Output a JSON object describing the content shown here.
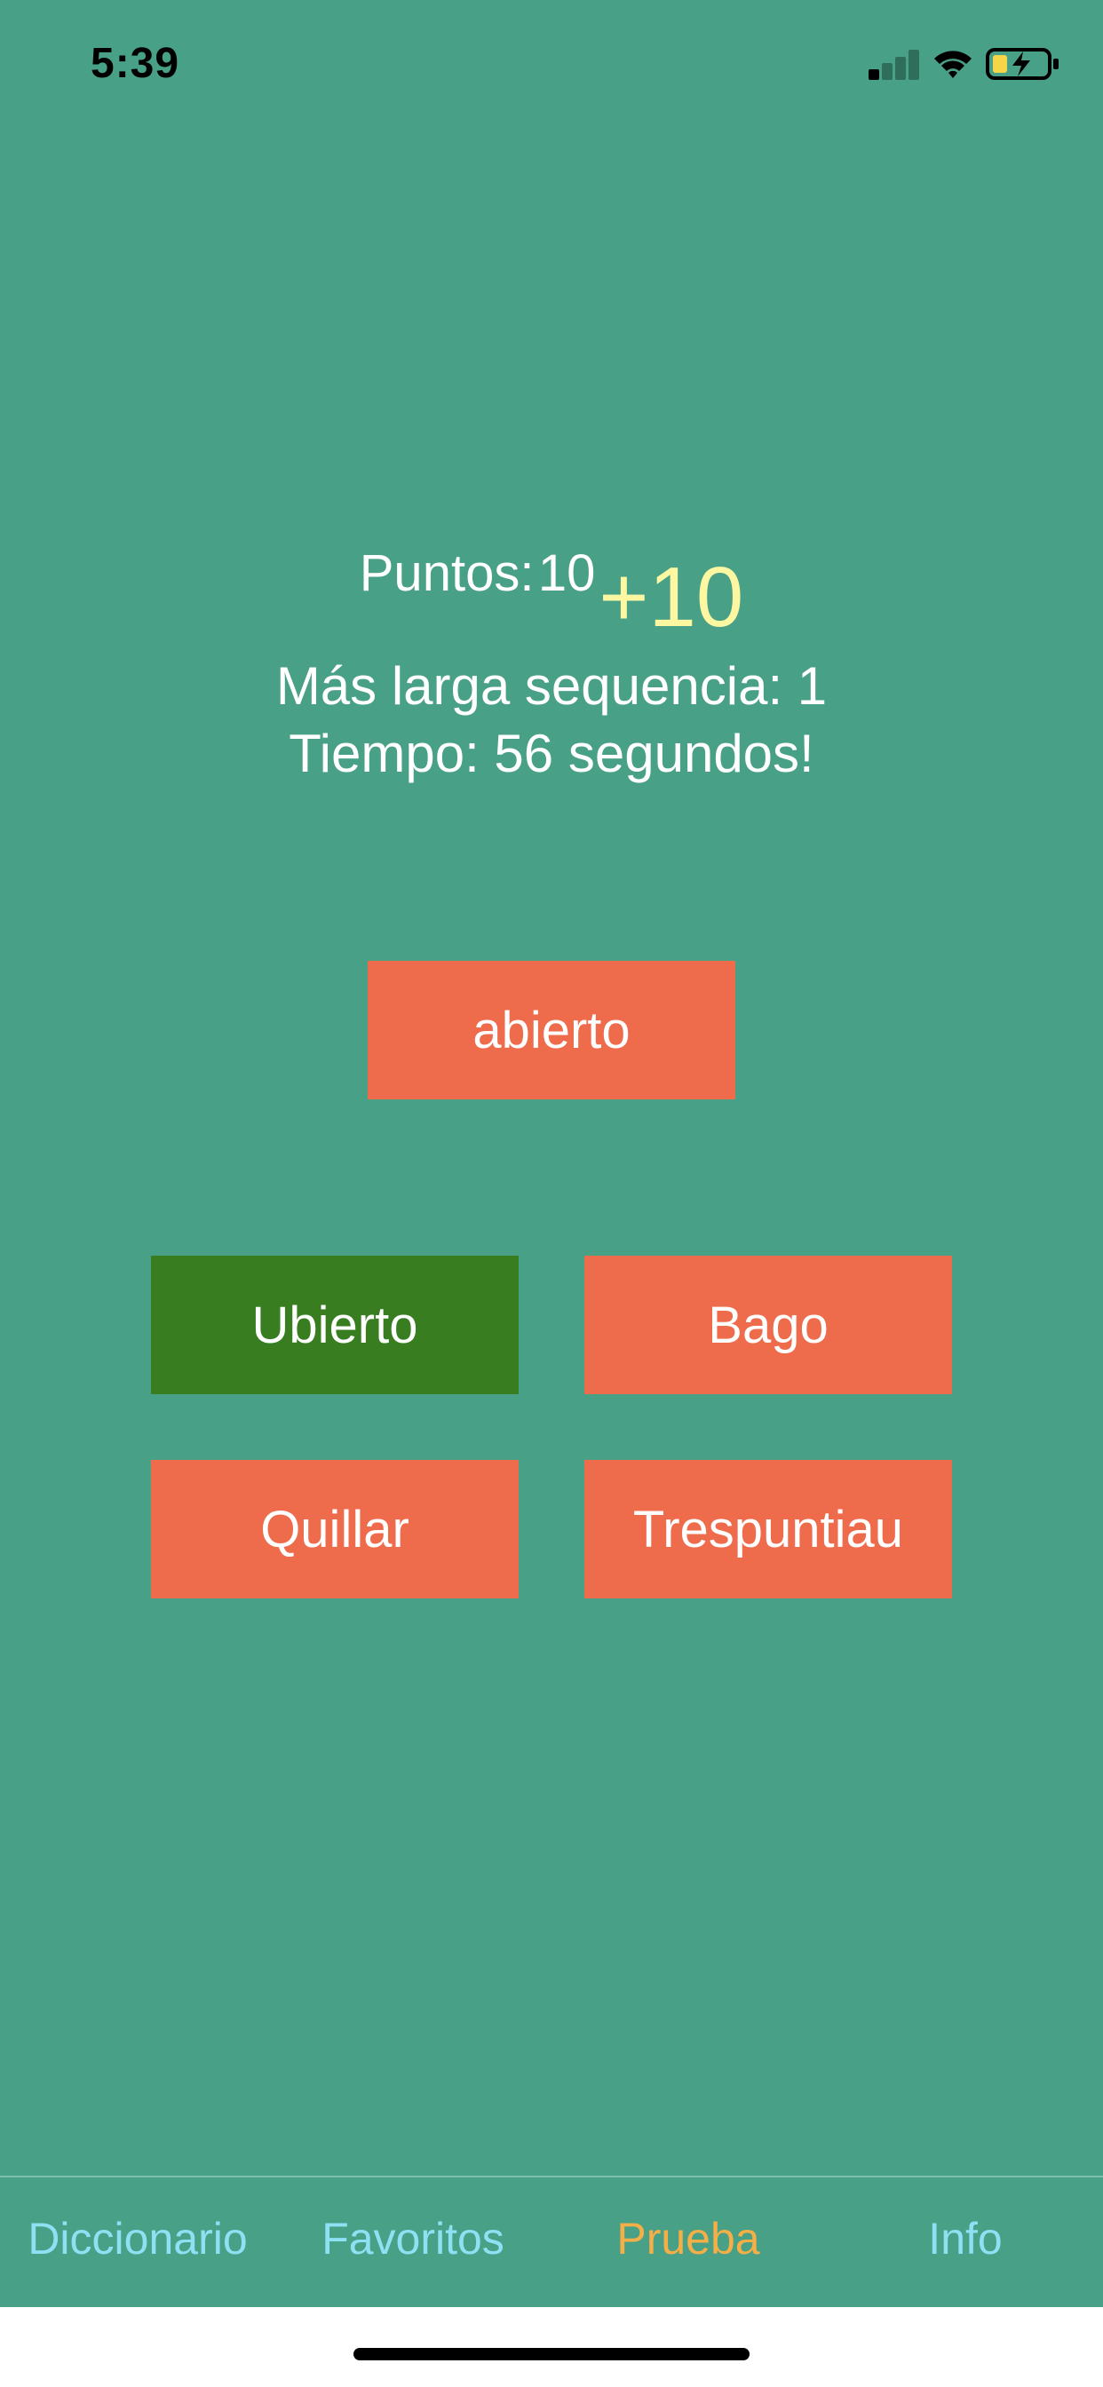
{
  "status_bar": {
    "time": "5:39"
  },
  "score": {
    "label": "Puntos:",
    "value": "10",
    "bonus": "+10",
    "streak": "Más larga sequencia: 1",
    "time": "Tiempo: 56 segundos!"
  },
  "question": {
    "word": "abierto"
  },
  "answers": [
    {
      "label": "Ubierto",
      "state": "correct"
    },
    {
      "label": "Bago",
      "state": "default"
    },
    {
      "label": "Quillar",
      "state": "default"
    },
    {
      "label": "Trespuntiau",
      "state": "default"
    }
  ],
  "tabs": [
    {
      "label": "Diccionario",
      "active": false
    },
    {
      "label": "Favoritos",
      "active": false
    },
    {
      "label": "Prueba",
      "active": true
    },
    {
      "label": "Info",
      "active": false
    }
  ],
  "colors": {
    "background": "#48A087",
    "button": "#EE6B4B",
    "correct": "#387E21",
    "tab_inactive": "#8EE0F3",
    "tab_active": "#F5AF46",
    "bonus": "#FDF7A2"
  },
  "icons": [
    "cellular-signal-icon",
    "wifi-icon",
    "battery-charging-icon"
  ]
}
